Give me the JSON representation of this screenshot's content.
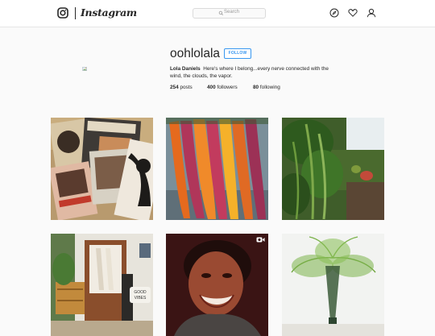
{
  "nav": {
    "wordmark": "Instagram",
    "search_placeholder": "Search",
    "icons": [
      "instagram-glyph-icon",
      "compass-icon",
      "heart-icon",
      "person-icon"
    ]
  },
  "profile": {
    "username": "oohlolala",
    "follow_label": "FOLLOW",
    "full_name": "Lola Daniels",
    "bio": "Here's where I belong...every nerve connected with the wind, the clouds, the vapor.",
    "stats": {
      "posts_count": "254",
      "posts_label": "posts",
      "followers_count": "400",
      "followers_label": "followers",
      "following_count": "80",
      "following_label": "following"
    }
  },
  "posts": [
    {
      "subject": "vinyl records"
    },
    {
      "subject": "rainbow carrots"
    },
    {
      "subject": "garden pea vines"
    },
    {
      "subject": "rustic room interior",
      "sign_text": "GOOD VIBES"
    },
    {
      "subject": "smiling woman video",
      "badge_icon": "video-camera-icon"
    },
    {
      "subject": "asparagus fern in vase"
    }
  ],
  "colors": {
    "accent": "#3897f0",
    "text": "#262626",
    "background": "#fafafa",
    "border": "#dbdbdb"
  }
}
